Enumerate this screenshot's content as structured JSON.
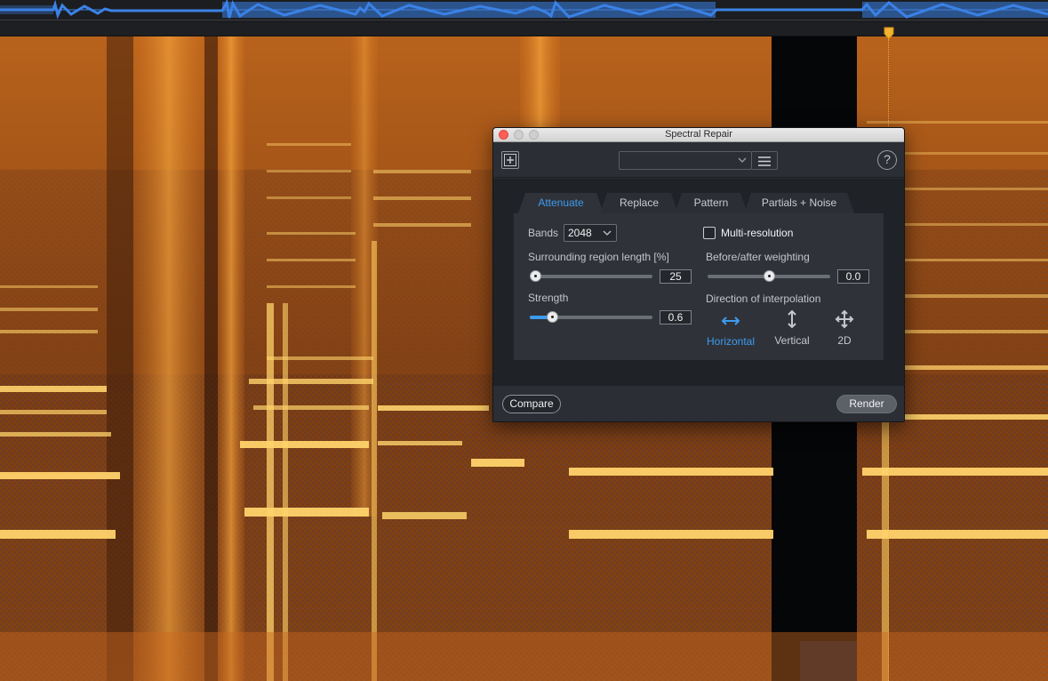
{
  "colors": {
    "accent": "#3d9bf0",
    "spectro_hot": "#ffd36b",
    "spectro_warm": "#e07a1c",
    "spectro_dark": "#3a1a08",
    "waveform": "#3b82e6",
    "playhead": "#f3c24a"
  },
  "dialog": {
    "title": "Spectral Repair",
    "preset_value": "",
    "help_symbol": "?",
    "tabs": [
      "Attenuate",
      "Replace",
      "Pattern",
      "Partials + Noise"
    ],
    "active_tab": "Attenuate",
    "bands_label": "Bands",
    "bands_value": "2048",
    "multires_label": "Multi-resolution",
    "multires_checked": false,
    "surrounding_label": "Surrounding region length [%]",
    "surrounding_value": "25",
    "surrounding_level": 0.0,
    "strength_label": "Strength",
    "strength_value": "0.6",
    "strength_level": 0.15,
    "weighting_label": "Before/after weighting",
    "weighting_value": "0.0",
    "weighting_level": 0.5,
    "direction_label": "Direction of interpolation",
    "directions": [
      "Horizontal",
      "Vertical",
      "2D"
    ],
    "active_direction": "Horizontal",
    "compare_label": "Compare",
    "render_label": "Render"
  }
}
